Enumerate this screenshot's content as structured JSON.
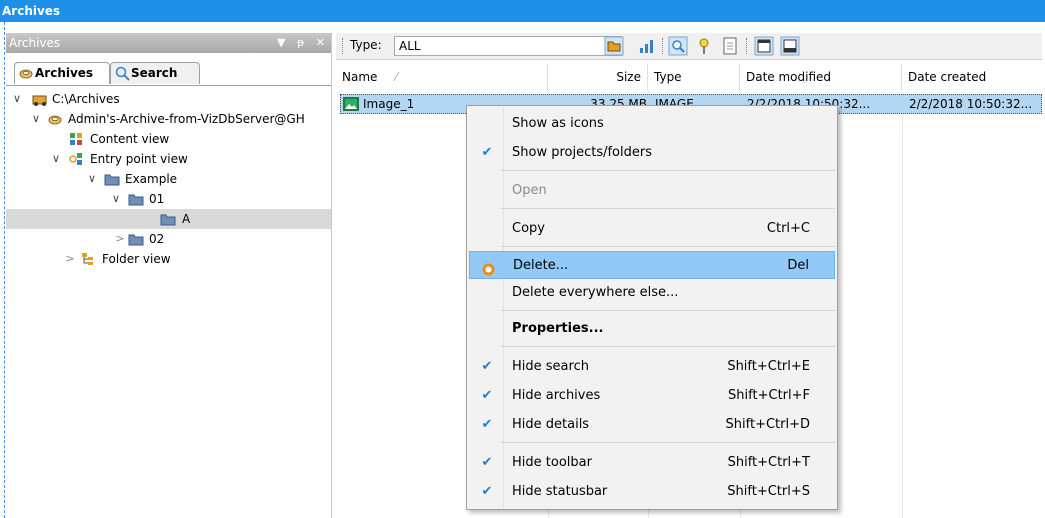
{
  "window": {
    "title": "Archives"
  },
  "left_panel": {
    "title": "Archives",
    "btn_dropdown": "▼",
    "btn_pin": "ᵽ",
    "btn_close": "✕",
    "tabs": [
      {
        "label": "Archives",
        "icon": "archive-icon"
      },
      {
        "label": "Search",
        "icon": "search-icon"
      }
    ],
    "tree": [
      {
        "label": "C:\\Archives",
        "icon": "drive-icon",
        "chevron": "∨"
      },
      {
        "label": "Admin's-Archive-from-VizDbServer@GH",
        "icon": "archive-icon",
        "chevron": "∨"
      },
      {
        "label": "Content view",
        "icon": "grid-icon",
        "chevron": ""
      },
      {
        "label": "Entry point view",
        "icon": "entry-point-icon",
        "chevron": "∨"
      },
      {
        "label": "Example",
        "icon": "folder-icon",
        "chevron": "∨"
      },
      {
        "label": "01",
        "icon": "folder-icon",
        "chevron": "∨"
      },
      {
        "label": "A",
        "icon": "folder-icon",
        "chevron": ""
      },
      {
        "label": "02",
        "icon": "folder-icon",
        "chevron": ">"
      },
      {
        "label": "Folder view",
        "icon": "folder-tree-icon",
        "chevron": ">"
      }
    ]
  },
  "toolbar": {
    "type_label": "Type:",
    "type_value": "ALL",
    "dropdown_icon": "chevron-down-icon"
  },
  "columns": {
    "name": "Name",
    "size": "Size",
    "type": "Type",
    "date_modified": "Date modified",
    "date_created": "Date created"
  },
  "files": [
    {
      "name": "Image_1",
      "size": "33.25 MB",
      "type": "IMAGE",
      "date_modified": "2/2/2018 10:50:32...",
      "date_created": "2/2/2018 10:50:32..."
    }
  ],
  "context_menu": {
    "items": [
      {
        "label": "Show as icons",
        "shortcut": "",
        "checked": false
      },
      {
        "label": "Show projects/folders",
        "shortcut": "",
        "checked": true
      },
      {
        "label": "Open",
        "shortcut": "",
        "checked": false,
        "disabled": true
      },
      {
        "label": "Copy",
        "shortcut": "Ctrl+C",
        "checked": false
      },
      {
        "label": "Delete...",
        "shortcut": "Del",
        "checked": false
      },
      {
        "label": "Delete everywhere else...",
        "shortcut": "",
        "checked": false
      },
      {
        "label": "Properties...",
        "shortcut": "",
        "checked": false
      },
      {
        "label": "Hide search",
        "shortcut": "Shift+Ctrl+E",
        "checked": true
      },
      {
        "label": "Hide archives",
        "shortcut": "Shift+Ctrl+F",
        "checked": true
      },
      {
        "label": "Hide details",
        "shortcut": "Shift+Ctrl+D",
        "checked": true
      },
      {
        "label": "Hide toolbar",
        "shortcut": "Shift+Ctrl+T",
        "checked": true
      },
      {
        "label": "Hide statusbar",
        "shortcut": "Shift+Ctrl+S",
        "checked": true
      }
    ],
    "check_glyph": "✔"
  },
  "colors": {
    "titlebar": "#1e90e8",
    "selection": "#b3d7f3",
    "menu_hover": "#91c9f7"
  }
}
